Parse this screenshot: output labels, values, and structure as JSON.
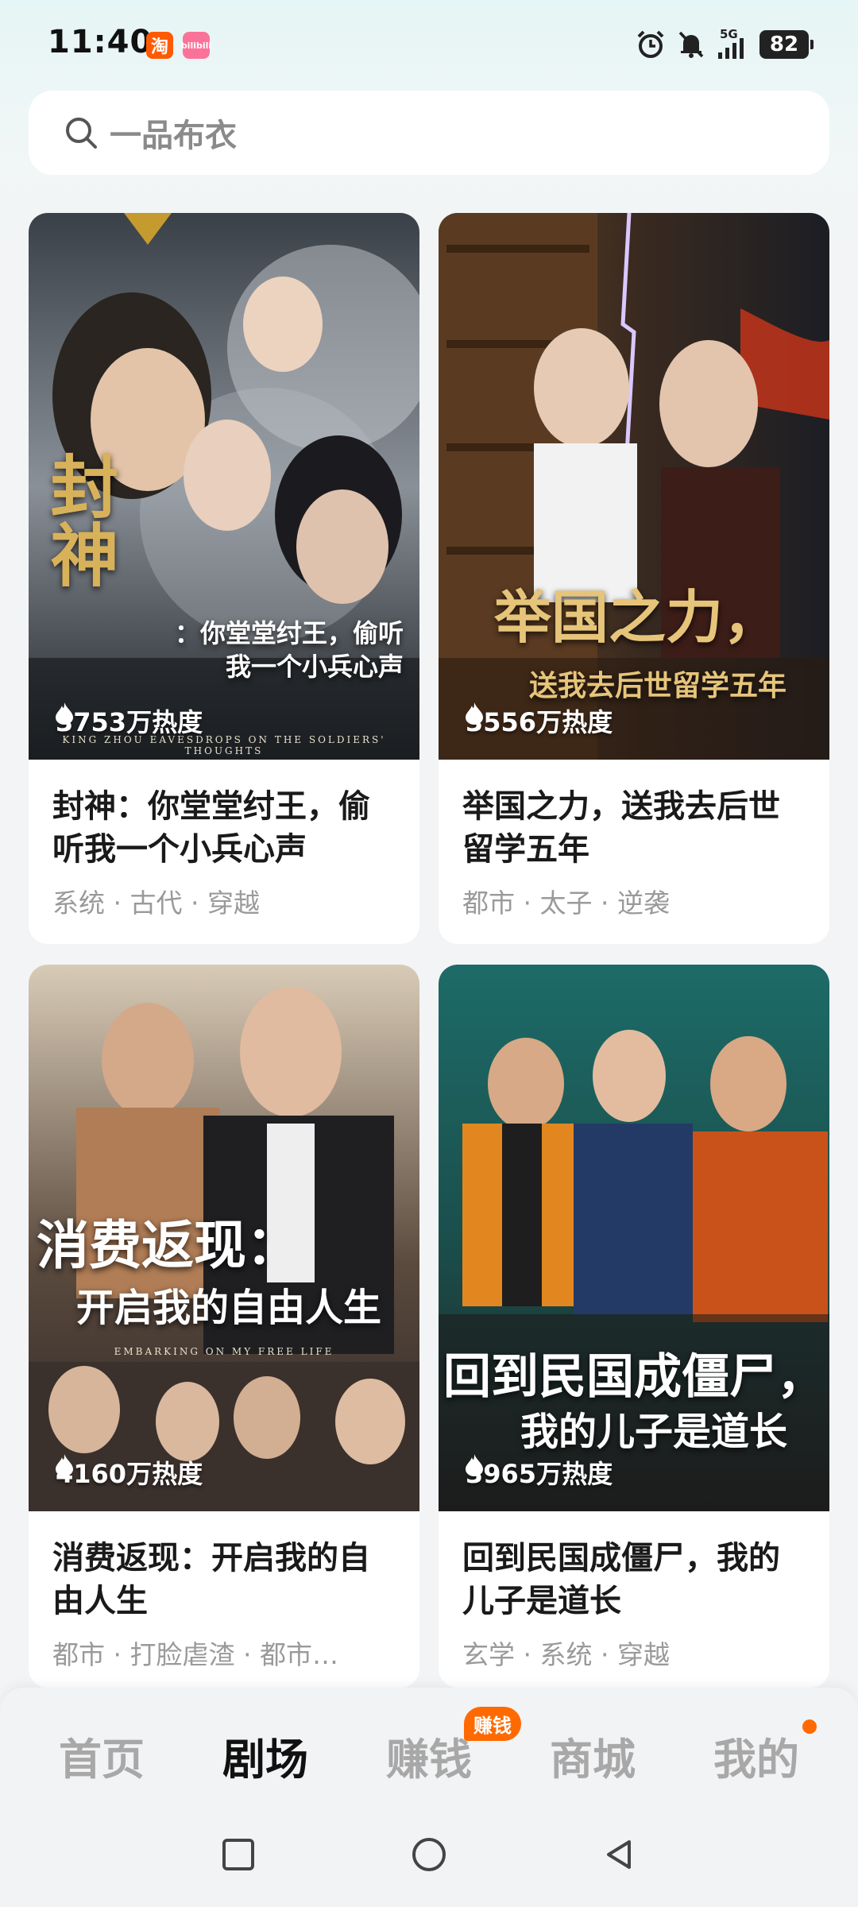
{
  "status": {
    "time": "11:40",
    "app_icon_1": "淘",
    "app_icon_2": "bilibili",
    "network": "5G",
    "battery": "82"
  },
  "search": {
    "placeholder": "一品布衣"
  },
  "cards": [
    {
      "poster_title": "封神",
      "poster_subtitle": "：你堂堂纣王，偷听我一个小兵心声",
      "poster_english": "KING ZHOU EAVESDROPS ON THE SOLDIERS' THOUGHTS",
      "heat": "3753万热度",
      "title": "封神：你堂堂纣王，偷听我一个小兵心声",
      "tags": "系统 · 古代 · 穿越"
    },
    {
      "poster_title": "举国之力，",
      "poster_subtitle": "送我去后世留学五年",
      "heat": "3556万热度",
      "title": "举国之力，送我去后世留学五年",
      "tags": "都市 · 太子 · 逆袭"
    },
    {
      "poster_title": "消费返现：",
      "poster_subtitle": "开启我的自由人生",
      "poster_english": "EMBARKING ON MY FREE LIFE",
      "heat": "4160万热度",
      "title": "消费返现：开启我的自由人生",
      "tags": "都市 · 打脸虐渣 · 都市…"
    },
    {
      "poster_title": "回到民国成僵尸，",
      "poster_subtitle": "我的儿子是道长",
      "heat": "3965万热度",
      "title": "回到民国成僵尸，我的儿子是道长",
      "tags": "玄学 · 系统 · 穿越"
    }
  ],
  "nav": {
    "home": "首页",
    "theater": "剧场",
    "earn": "赚钱",
    "earn_badge": "赚钱",
    "mall": "商城",
    "mine": "我的"
  },
  "colors": {
    "accent": "#ff6a00",
    "active_text": "#111111",
    "inactive_text": "#a8a8a8"
  }
}
